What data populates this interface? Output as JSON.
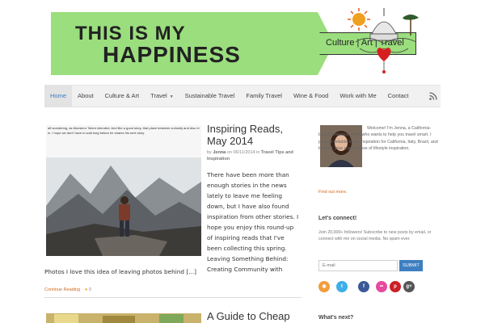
{
  "header": {
    "title_line1": "THIS IS MY",
    "title_line2": "HAPPINESS",
    "tagline": "Culture | Art | Travel"
  },
  "nav": {
    "items": [
      {
        "label": "Home",
        "active": true
      },
      {
        "label": "About"
      },
      {
        "label": "Culture & Art"
      },
      {
        "label": "Travel",
        "has_dropdown": true
      },
      {
        "label": "Sustainable Travel"
      },
      {
        "label": "Family Travel"
      },
      {
        "label": "Wine & Food"
      },
      {
        "label": "Work with Me"
      },
      {
        "label": "Contact"
      }
    ],
    "rss_icon": "rss-icon"
  },
  "post1": {
    "thumb_caption": "aft wondering, as Monsieur Toben intended. And like a good story, that place between curiosity and disc re in. I hope we don't have to wait long before he shares his next story.",
    "title": "Inspiring Reads, May 2014",
    "meta_by": "by",
    "author": "Jenna",
    "meta_on": "on",
    "date": "06/11/2014",
    "meta_in": "in",
    "category": "Travel Tips and Inspiration",
    "excerpt": "There have been more than enough stories in the news lately to leave me feeling down, but I have also found inspiration from other stories. I hope you enjoy this round-up of inspiring reads that I've been collecting this spring. Leaving Something Behind: Creating Community with",
    "excerpt_continued": "Photos I love this idea of leaving photos behind [...]",
    "continue_label": "Continue Reading",
    "comments": "0"
  },
  "post2": {
    "title": "A Guide to Cheap"
  },
  "sidebar": {
    "bio": "Welcome! I'm Jenna, a California-based freelance writer who wants to help you travel smart. I provide reliable travel inspiration for California, Italy, Brazil, and beyond, plus a good dose of lifestyle inspiration.",
    "find_out_more": "Find out more.",
    "connect_heading": "Let's connect!",
    "connect_text": "Join 20,000+ followers! Subscribe to new posts by email, or connect with me on social media. No spam ever.",
    "email_placeholder": "E-mail",
    "submit_label": "SUBMIT",
    "social_icons": [
      {
        "name": "rss-icon",
        "color": "#f39c3c",
        "glyph": "◉"
      },
      {
        "name": "twitter-icon",
        "color": "#3eaee8",
        "glyph": "t"
      },
      {
        "name": "facebook-icon",
        "color": "#3b5998",
        "glyph": "f"
      },
      {
        "name": "flickr-icon",
        "color": "#e64a9c",
        "glyph": "••"
      },
      {
        "name": "pinterest-icon",
        "color": "#cb2027",
        "glyph": "p"
      },
      {
        "name": "google-plus-icon",
        "color": "#555555",
        "glyph": "g+"
      }
    ],
    "whats_next_heading": "What's next?"
  },
  "colors": {
    "banner_green": "#9bde7e",
    "link_orange": "#d2691e",
    "active_nav_blue": "#3b7bc8",
    "submit_blue": "#3e7fc1"
  }
}
